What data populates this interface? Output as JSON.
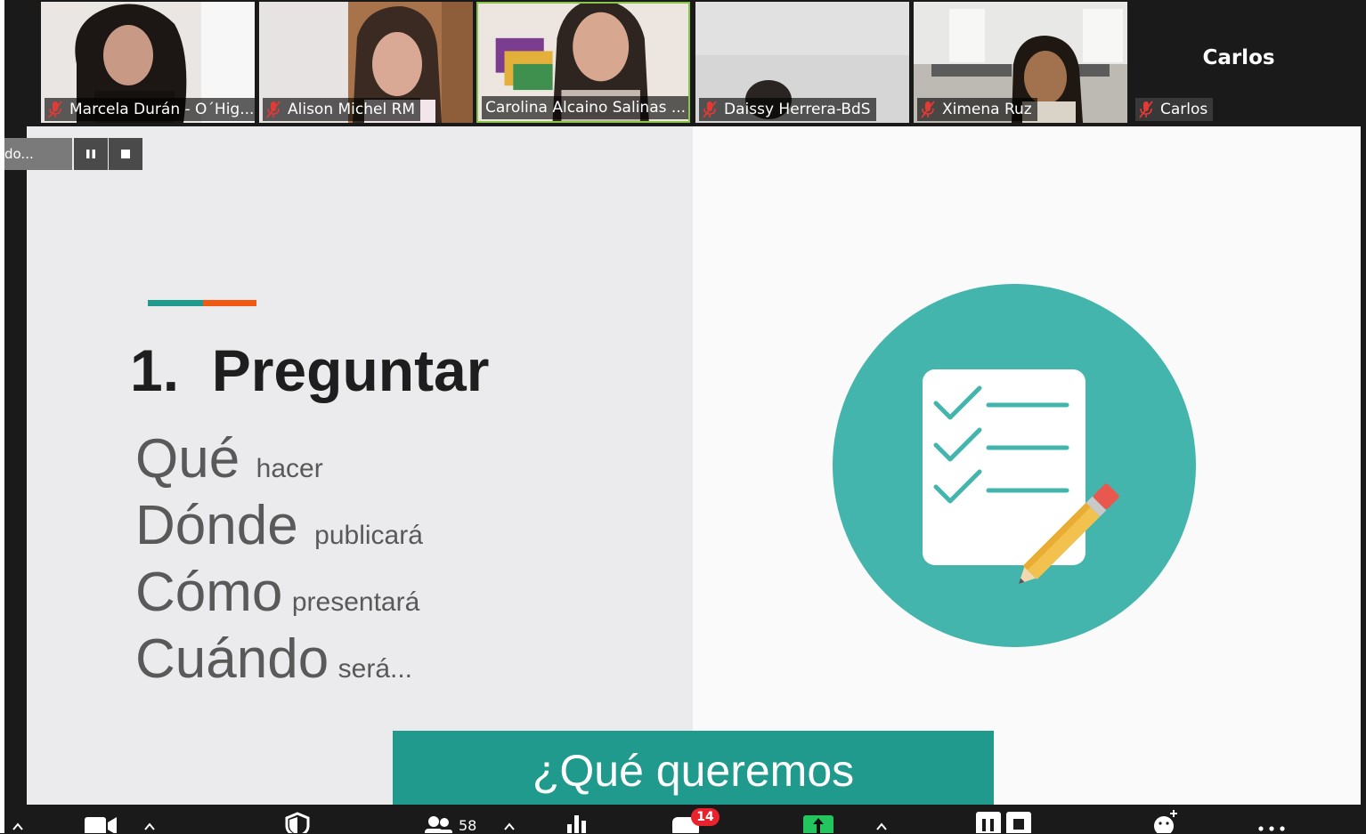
{
  "participants": [
    {
      "name": "Marcela Durán - O´Hig...",
      "muted": true
    },
    {
      "name": "Alison Michel RM",
      "muted": true
    },
    {
      "name": "Carolina Alcaino Salinas ...",
      "muted": false,
      "active_speaker": true
    },
    {
      "name": "Daissy Herrera-BdS",
      "muted": true
    },
    {
      "name": "Ximena Ruz",
      "muted": true
    },
    {
      "name": "Carlos",
      "muted": true,
      "video_off": true,
      "display_name": "Carlos"
    }
  ],
  "recording": {
    "label": "do...",
    "pause_icon": "pause-icon",
    "stop_icon": "stop-icon"
  },
  "slide": {
    "title": "1.  Preguntar",
    "lines": [
      {
        "word": "Qué",
        "sub": "hacer"
      },
      {
        "word": "Dónde",
        "sub": "publicará"
      },
      {
        "word": "Cómo",
        "sub": "presentará"
      },
      {
        "word": "Cuándo",
        "sub": "será..."
      }
    ],
    "banner": "¿Qué queremos",
    "illustration": "checklist-pencil-icon"
  },
  "toolbar": {
    "participants_count": "58",
    "chat_badge": "14"
  },
  "colors": {
    "accent_teal": "#1f9a8c",
    "accent_orange": "#f05a14",
    "circle_teal": "#44b5ad",
    "active_border": "#8ac34a",
    "badge_red": "#e8232e",
    "share_green": "#22c55e"
  }
}
